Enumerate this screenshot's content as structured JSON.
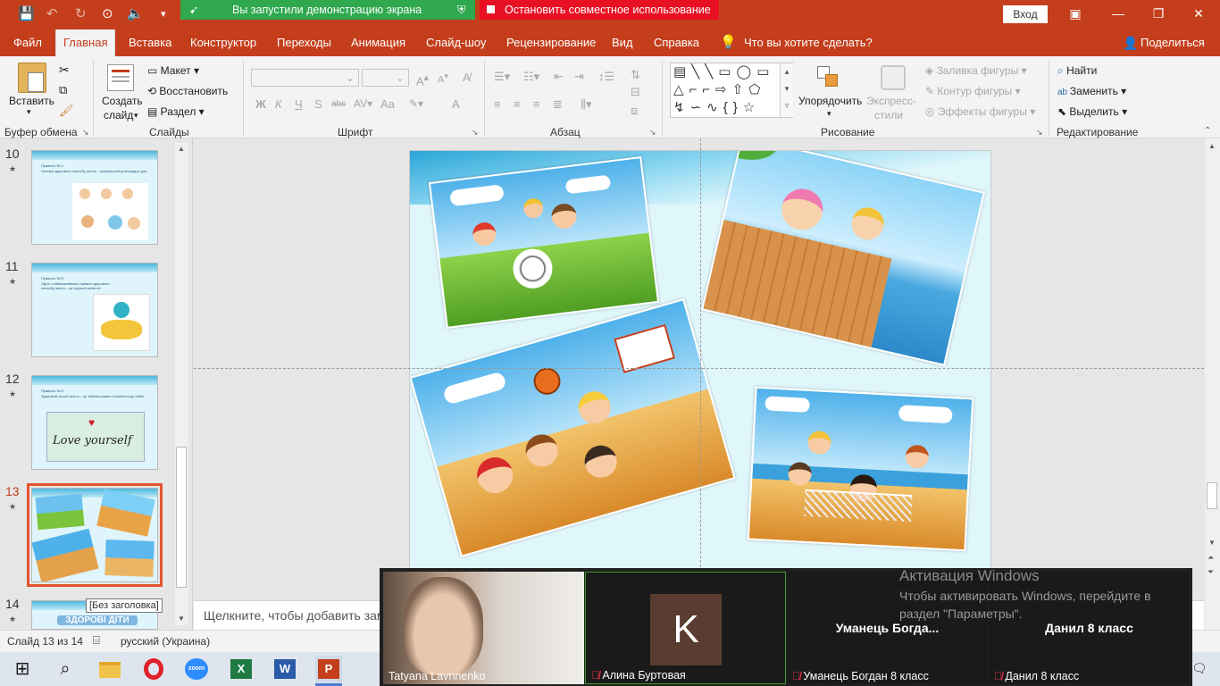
{
  "titlebar": {
    "share_status": "Вы запустили демонстрацию экрана",
    "stop_share": "Остановить совместное использование",
    "login": "Вход",
    "minimize_glyph": "—",
    "restore_glyph": "❐",
    "close_glyph": "✕"
  },
  "tabs": [
    "Файл",
    "Главная",
    "Вставка",
    "Конструктор",
    "Переходы",
    "Анимация",
    "Слайд-шоу",
    "Рецензирование",
    "Вид",
    "Справка"
  ],
  "search": {
    "placeholder": "Что вы хотите сделать?"
  },
  "share_button": "Поделиться",
  "ribbon": {
    "clipboard": {
      "paste": "Вставить",
      "label": "Буфер обмена"
    },
    "slides": {
      "new_slide_line1": "Создать",
      "new_slide_line2": "слайд",
      "layout": "Макет",
      "reset": "Восстановить",
      "section": "Раздел",
      "label": "Слайды"
    },
    "font": {
      "bold": "Ж",
      "italic": "К",
      "underline": "Ч",
      "shadow": "S",
      "strike": "abc",
      "case": "Aa",
      "color": "A",
      "label": "Шрифт"
    },
    "paragraph": {
      "label": "Абзац"
    },
    "drawing": {
      "arrange": "Упорядочить",
      "styles_line1": "Экспресс-",
      "styles_line2": "стили",
      "fill": "Заливка фигуры",
      "outline": "Контур фигуры",
      "effects": "Эффекты фигуры",
      "label": "Рисование"
    },
    "editing": {
      "find": "Найти",
      "replace": "Заменить",
      "select": "Выделить",
      "label": "Редактирование"
    }
  },
  "slides": [
    {
      "number": "10",
      "line1": "Правило № 4",
      "line2": "Основа здорового способу життя – правильний розпорядок дня."
    },
    {
      "number": "11",
      "line1": "Правило № 5",
      "line2": "Одне з найважливіших правил здорового способу життя – це корисні заняття!"
    },
    {
      "number": "12",
      "line1": "Правило № 6",
      "line2": "Здоровий спосіб життя – це збалансоване ставлення до себе!",
      "image_text": "Love yourself"
    },
    {
      "number": "13"
    },
    {
      "number": "14",
      "title": "ЗДОРОВІ ДІТИ"
    }
  ],
  "tooltip": "[Без заголовка]",
  "notes": {
    "placeholder": "Щелкните, чтобы добавить заметки"
  },
  "status": {
    "slide": "Слайд 13 из 14",
    "language": "русский (Украина)"
  },
  "video": {
    "participants": [
      {
        "name": "Tatyana Lavrinenko"
      },
      {
        "name": "Алина Буртовая",
        "initial": "K"
      },
      {
        "name": "Уманець Богдан 8 класс",
        "display": "Уманець  Богда..."
      },
      {
        "name": "Данил 8 класс",
        "display": "Данил 8 класс"
      }
    ]
  },
  "activation": {
    "title": "Активация Windows",
    "text": "Чтобы активировать Windows, перейдите в раздел \"Параметры\"."
  },
  "taskbar": [
    "start-icon",
    "search-icon",
    "explorer-icon",
    "opera-icon",
    "zoom-icon",
    "excel-icon",
    "word-icon",
    "powerpoint-icon"
  ],
  "colors": {
    "accent": "#c43e1c",
    "share_green": "#2fa84f",
    "share_red": "#e81123",
    "selection": "#e2542f"
  }
}
